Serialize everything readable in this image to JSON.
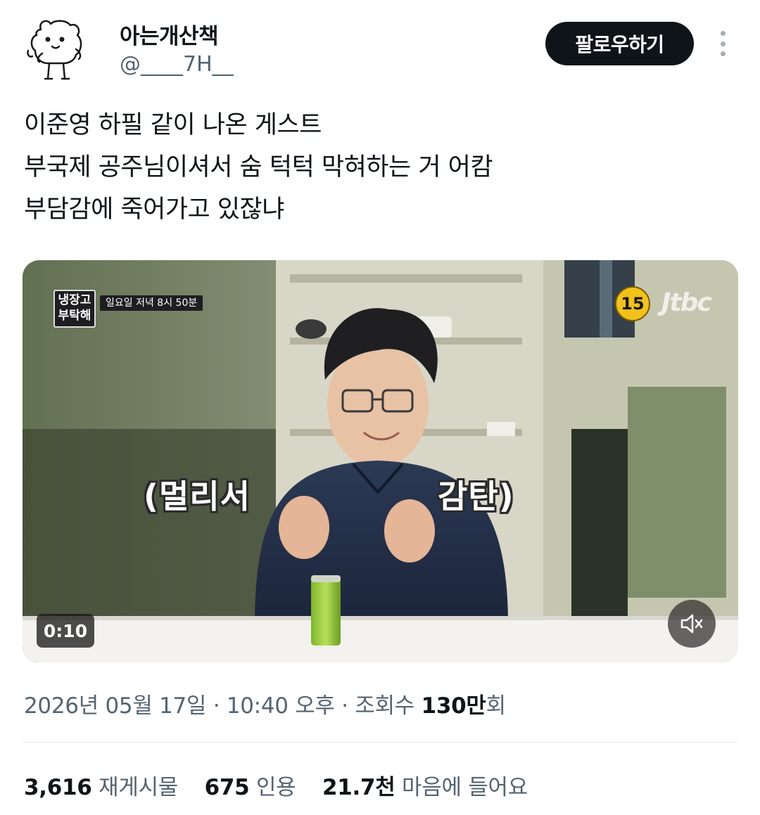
{
  "user": {
    "display_name": "아는개산책",
    "handle": "@____7H__",
    "avatar_icon": "cartoon-dog-icon"
  },
  "follow_button": {
    "label": "팔로우하기"
  },
  "more_icon": "more-vertical-icon",
  "tweet": {
    "lines": [
      "이준영 하필 같이 나온 게스트",
      "부국제 공주님이셔서 숨 턱턱 막혀하는 거 어캄",
      "부담감에 죽어가고 있잖냐"
    ]
  },
  "video": {
    "show_logo_line1": "냉장고",
    "show_logo_line2": "부탁해",
    "schedule_text": "일요일 저녁 8시 50분",
    "rating": "15",
    "channel": "Jtbc",
    "subtitle_left": "(멀리서",
    "subtitle_right": "감탄)",
    "duration": "0:10",
    "mute_icon": "volume-muted-icon"
  },
  "meta": {
    "date": "2026년 05월 17일",
    "sep1": " · ",
    "time": "10:40 오후",
    "sep2": " · ",
    "views_label": "조회수 ",
    "views_number": "130만",
    "views_suffix": "회"
  },
  "stats": {
    "reposts_count": "3,616",
    "reposts_label": "재게시물",
    "quotes_count": "675",
    "quotes_label": "인용",
    "likes_count": "21.7천",
    "likes_label": "마음에 들어요"
  }
}
